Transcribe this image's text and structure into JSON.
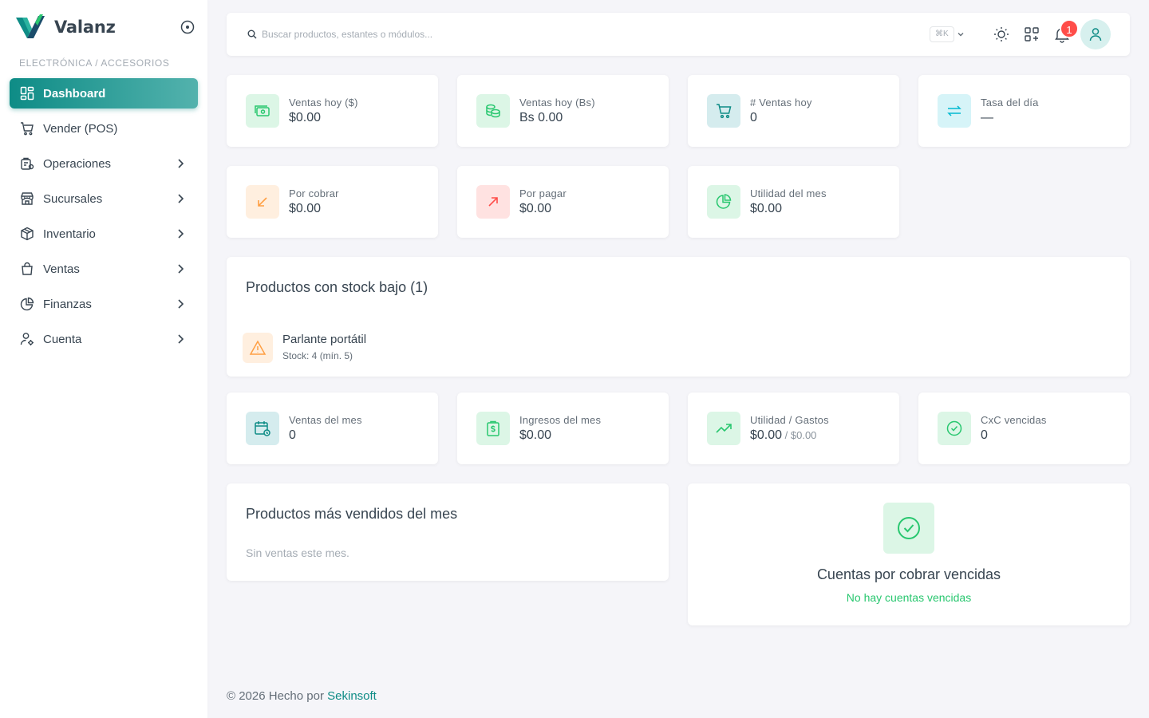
{
  "brand": {
    "name": "Valanz"
  },
  "sidebar": {
    "section_label": "ELECTRÓNICA / ACCESORIOS",
    "items": [
      {
        "label": "Dashboard",
        "icon": "dashboard-icon",
        "active": true,
        "has_children": false
      },
      {
        "label": "Vender (POS)",
        "icon": "cart-icon",
        "active": false,
        "has_children": false
      },
      {
        "label": "Operaciones",
        "icon": "operations-icon",
        "active": false,
        "has_children": true
      },
      {
        "label": "Sucursales",
        "icon": "store-icon",
        "active": false,
        "has_children": true
      },
      {
        "label": "Inventario",
        "icon": "box-icon",
        "active": false,
        "has_children": true
      },
      {
        "label": "Ventas",
        "icon": "shopping-bag-icon",
        "active": false,
        "has_children": true
      },
      {
        "label": "Finanzas",
        "icon": "pie-chart-icon",
        "active": false,
        "has_children": true
      },
      {
        "label": "Cuenta",
        "icon": "user-settings-icon",
        "active": false,
        "has_children": true
      }
    ]
  },
  "topbar": {
    "search_placeholder": "Buscar productos, estantes o módulos...",
    "shortcut": "⌘K",
    "notification_count": "1"
  },
  "stats_top": [
    {
      "label": "Ventas hoy ($)",
      "value": "$0.00",
      "icon": "cash-icon",
      "color": "green"
    },
    {
      "label": "Ventas hoy (Bs)",
      "value": "Bs 0.00",
      "icon": "coins-icon",
      "color": "green"
    },
    {
      "label": "# Ventas hoy",
      "value": "0",
      "icon": "cart-icon",
      "color": "teal"
    },
    {
      "label": "Tasa del día",
      "value": "—",
      "icon": "exchange-icon",
      "color": "cyan"
    }
  ],
  "stats_mid": [
    {
      "label": "Por cobrar",
      "value": "$0.00",
      "icon": "arrow-down-left-icon",
      "color": "orange"
    },
    {
      "label": "Por pagar",
      "value": "$0.00",
      "icon": "arrow-up-right-icon",
      "color": "red"
    },
    {
      "label": "Utilidad del mes",
      "value": "$0.00",
      "icon": "pie-chart-icon",
      "color": "green"
    }
  ],
  "low_stock": {
    "title": "Productos con stock bajo (1)",
    "items": [
      {
        "name": "Parlante portátil",
        "stock": "Stock: 4 (mín. 5)"
      }
    ]
  },
  "stats_bottom": [
    {
      "label": "Ventas del mes",
      "value": "0",
      "icon": "calendar-clock-icon",
      "color": "teal"
    },
    {
      "label": "Ingresos del mes",
      "value": "$0.00",
      "icon": "receipt-dollar-icon",
      "color": "green"
    },
    {
      "label": "Utilidad / Gastos",
      "value": "$0.00",
      "value_sub": " / $0.00",
      "icon": "trending-up-icon",
      "color": "green"
    },
    {
      "label": "CxC vencidas",
      "value": "0",
      "icon": "check-circle-icon",
      "color": "green"
    }
  ],
  "top_products": {
    "title": "Productos más vendidos del mes",
    "empty": "Sin ventas este mes."
  },
  "overdue": {
    "title": "Cuentas por cobrar vencidas",
    "subtitle": "No hay cuentas vencidas"
  },
  "footer": {
    "text": "© 2026 Hecho por ",
    "link": "Sekinsoft"
  },
  "colors": {
    "primary": "#0e8c86",
    "success": "#28c76f",
    "danger": "#ff4d49",
    "warning": "#ff9f43"
  }
}
